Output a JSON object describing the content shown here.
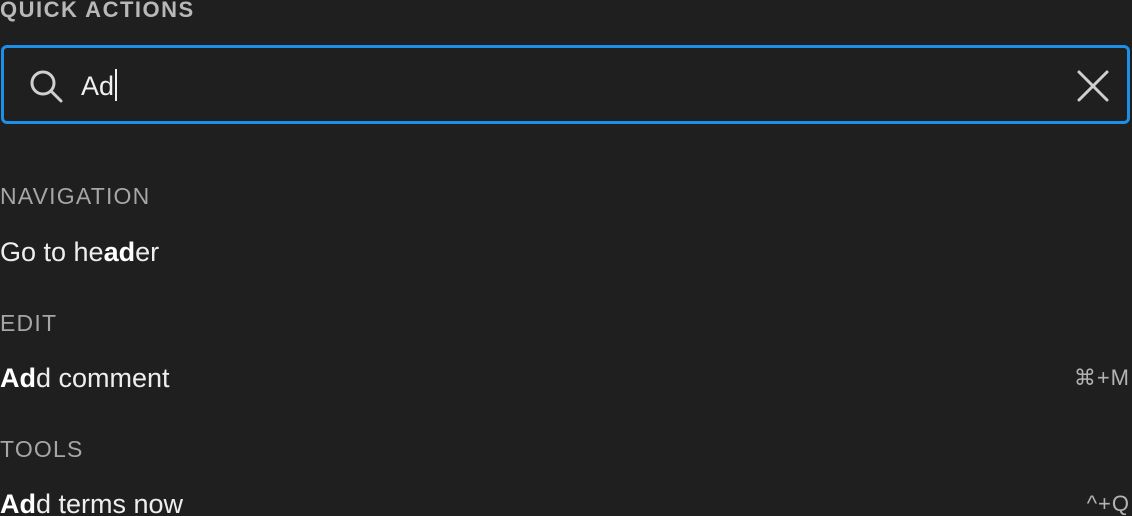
{
  "panel": {
    "title": "QUICK ACTIONS"
  },
  "search": {
    "value": "Ad",
    "icon": "search-icon",
    "clear_icon": "close-icon"
  },
  "sections": [
    {
      "title": "NAVIGATION",
      "items": [
        {
          "pre": "Go to he",
          "match": "ad",
          "post": "er",
          "shortcut": ""
        }
      ]
    },
    {
      "title": "EDIT",
      "items": [
        {
          "pre": "",
          "match": "Ad",
          "post": "d comment",
          "shortcut": "⌘+M"
        }
      ]
    },
    {
      "title": "TOOLS",
      "items": [
        {
          "pre": "",
          "match": "Ad",
          "post": "d terms now",
          "shortcut": "^+Q"
        }
      ]
    }
  ],
  "colors": {
    "accent": "#1d8fe6",
    "background": "#1f1f1f"
  }
}
